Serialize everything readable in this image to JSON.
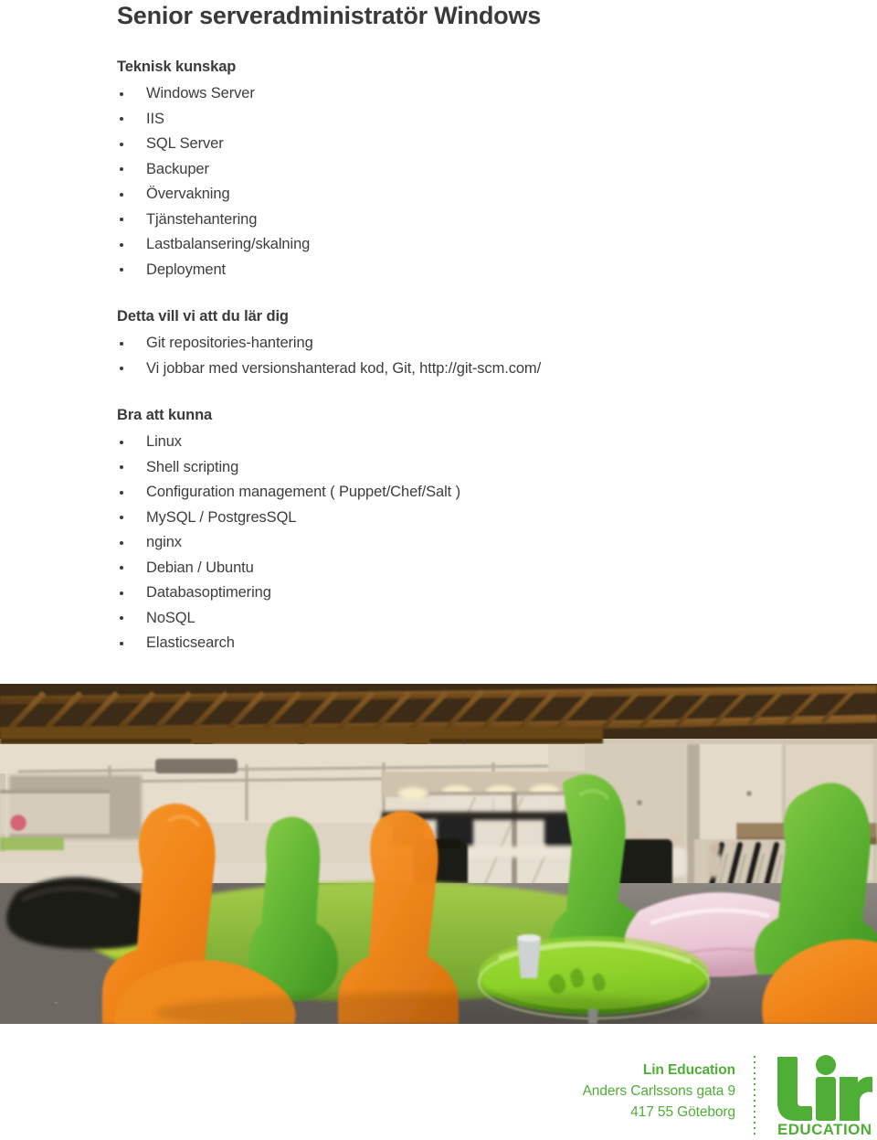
{
  "document": {
    "title": "Senior serveradministratör Windows",
    "sections": [
      {
        "heading": "Teknisk kunskap",
        "items": [
          "Windows Server",
          "IIS",
          "SQL Server",
          "Backuper",
          "Övervakning",
          "Tjänstehantering",
          "Lastbalansering/skalning",
          "Deployment"
        ]
      },
      {
        "heading": "Detta vill vi att du lär dig",
        "items": [
          "Git repositories-hantering",
          "Vi jobbar med versionshanterad kod, Git, http://git-scm.com/"
        ]
      },
      {
        "heading": "Bra att kunna",
        "items": [
          "Linux",
          "Shell scripting",
          "Configuration management ( Puppet/Chef/Salt )",
          "MySQL / PostgresSQL",
          "nginx",
          "Debian / Ubuntu",
          "Databasoptimering",
          "NoSQL",
          "Elasticsearch"
        ]
      }
    ]
  },
  "photo": {
    "alt": "Open-plan loft office with wooden roof trusses, orange and green sculpted lounge chairs, green glass coffee table, pink beanbag and grey carpet"
  },
  "footer": {
    "company": "Lin Education",
    "street": "Anders Carlssons gata 9",
    "city": "417 55 Göteborg",
    "logo_wordmark": "lin",
    "logo_subtext": "EDUCATION"
  },
  "colors": {
    "brand_green": "#4fae35",
    "text_dark": "#3a3a3a"
  }
}
